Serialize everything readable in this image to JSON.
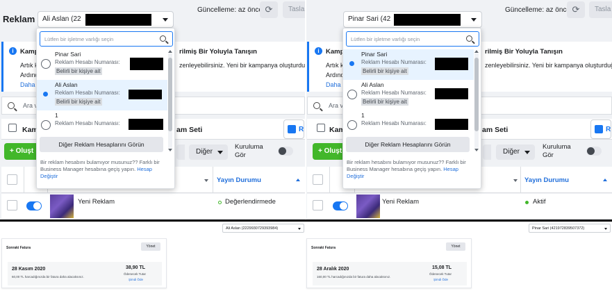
{
  "colors": {
    "accent": "#1877f2",
    "create_green": "#42b72a",
    "panel_bg": "#f0f2f5"
  },
  "icons": [
    "info-icon",
    "refresh-icon",
    "search-icon",
    "campaign-tab-icon",
    "chevron-down-icon"
  ],
  "left": {
    "brand": "Reklam",
    "account_select": "Ali Aslan (22",
    "update_text": "Güncelleme: az önce",
    "draft_button": "Tasla",
    "info": {
      "title_start": "Kampa",
      "title_end": "rilmiş Bir Yoluyla Tanışın",
      "line1_start": "Artık k",
      "line1_end": "zenleyebilirsiniz. Yeni bir kampanya oluşturduğu",
      "line2": "Ardınd",
      "link": "Daha f"
    },
    "search_label": "Ara ve",
    "tabs": {
      "campaigns": "Kam",
      "adset": "am Seti",
      "ads": "R"
    },
    "create_button": "+ Oluşt",
    "more_button": "Diğer",
    "toggle_label_1": "Kuruluma",
    "toggle_label_2": "Gör",
    "column_status": "Yayın Durumu",
    "row": {
      "name": "Yeni Reklam",
      "status": "Değerlendirmede"
    },
    "dropdown": {
      "search_placeholder": "Lütfen bir işletme varlığı seçin",
      "items": [
        {
          "name": "Pinar Sari",
          "account": "Reklam Hesabı Numarası:",
          "owner": "Belirli bir kişiye ait"
        },
        {
          "name": "Ali Aslan",
          "account": "Reklam Hesabı Numarası:",
          "owner": "Belirli bir kişiye ait"
        },
        {
          "name": "1",
          "account": "Reklam Hesabı Numarası:"
        }
      ],
      "more_accounts": "Diğer Reklam Hesaplarını Görün",
      "help_text": "Bir reklam hesabını bulamıyor musunuz?? Farklı bir Business Manager hesabına geçiş yapın.",
      "help_link": "Hesap Değiştir"
    },
    "billing": {
      "account_select": "Ali Aslan (2229930729393984)",
      "title": "Sonraki Fatura",
      "manage": "Yönet",
      "date": "28 Kasım 2020",
      "desc": "60,00 TL harcadığınızda bir fatura daha alacaksınız.",
      "amount": "38,90 TL",
      "due": "Ödenecek Tutar",
      "pay": "Şimdi Öde"
    }
  },
  "right": {
    "account_select": "Pinar Sari (42",
    "update_text": "Güncelleme: az önce",
    "draft_button": "Tasla",
    "info": {
      "title_start": "Kampa",
      "title_end": "rilmiş Bir Yoluyla Tanışın",
      "line1_start": "Artık k",
      "line1_end": "zenleyebilirsiniz. Yeni bir kampanya oluşturduğ",
      "line2": "Ardınd",
      "link": "Daha f"
    },
    "search_label": "Ara ve",
    "tabs": {
      "campaigns": "Kam",
      "adset": "am Seti",
      "ads": "R"
    },
    "create_button": "+ Oluşt",
    "more_button": "Diğer",
    "toggle_label_1": "Kuruluma",
    "toggle_label_2": "Gör",
    "column_status": "Yayın Durumu",
    "row": {
      "name": "Yeni Reklam",
      "status": "Aktif"
    },
    "dropdown": {
      "search_placeholder": "Lütfen bir işletme varlığı seçin",
      "items": [
        {
          "name": "Pinar Sari",
          "account": "Reklam Hesabı Numarası:",
          "owner": "Belirli bir kişiye ait"
        },
        {
          "name": "Ali Aslan",
          "account": "Reklam Hesabı Numarası:",
          "owner": "Belirli bir kişiye ait"
        },
        {
          "name": "1",
          "account": "Reklam Hesabı Numarası:"
        }
      ],
      "more_accounts": "Diğer Reklam Hesaplarını Görün",
      "help_text": "Bir reklam hesabını bulamıyor musunuz?? Farklı bir Business Manager hesabına geçiş yapın.",
      "help_link": "Hesap Değiştir"
    },
    "billing": {
      "account_select": "Pinar Sari (421972839507372)",
      "title": "Sonraki Fatura",
      "manage": "Yönet",
      "date": "28 Aralık 2020",
      "desc": "160,00 TL harcadığınızda bir fatura daha alacaksınız.",
      "amount": "15,08 TL",
      "due": "Ödenecek Tutar",
      "pay": "Şimdi Öde"
    }
  }
}
